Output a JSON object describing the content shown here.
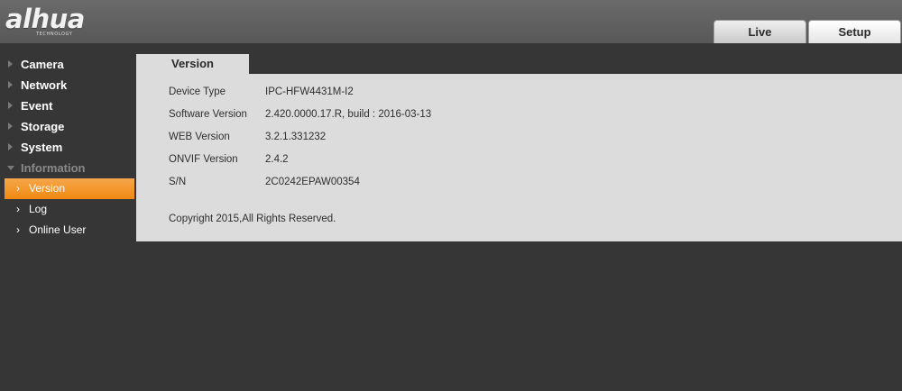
{
  "brand": {
    "logo_text": "alhua",
    "tagline": "TECHNOLOGY"
  },
  "top_tabs": {
    "live": "Live",
    "setup": "Setup"
  },
  "sidebar": {
    "items": [
      {
        "label": "Camera"
      },
      {
        "label": "Network"
      },
      {
        "label": "Event"
      },
      {
        "label": "Storage"
      },
      {
        "label": "System"
      },
      {
        "label": "Information"
      }
    ],
    "subitems": [
      {
        "label": "Version"
      },
      {
        "label": "Log"
      },
      {
        "label": "Online User"
      }
    ]
  },
  "panel": {
    "tab": "Version",
    "rows": [
      {
        "label": "Device Type",
        "value": "IPC-HFW4431M-I2"
      },
      {
        "label": "Software Version",
        "value": "2.420.0000.17.R, build : 2016-03-13"
      },
      {
        "label": "WEB Version",
        "value": "3.2.1.331232"
      },
      {
        "label": "ONVIF Version",
        "value": "2.4.2"
      },
      {
        "label": "S/N",
        "value": "2C0242EPAW00354"
      }
    ],
    "copyright": "Copyright 2015,All Rights Reserved."
  },
  "colors": {
    "accent": "#f08a12",
    "panel_bg": "#dcdcdc",
    "page_bg": "#363636"
  }
}
